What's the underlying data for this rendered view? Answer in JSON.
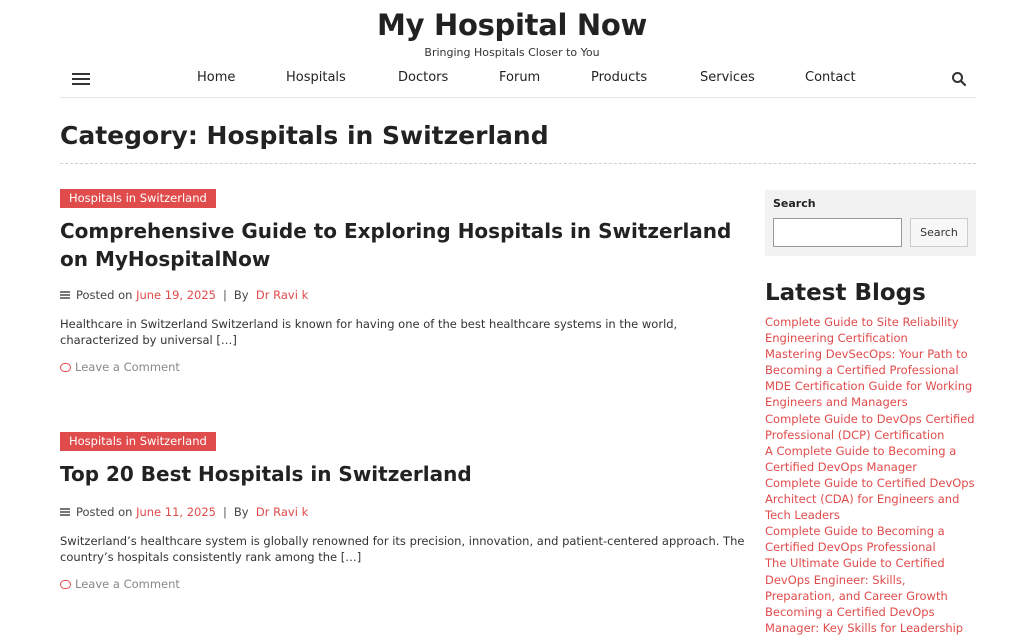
{
  "site": {
    "title": "My Hospital Now",
    "tagline": "Bringing Hospitals Closer to You"
  },
  "nav": {
    "menu_icon": "hamburger-menu-icon",
    "items": [
      "Home",
      "Hospitals",
      "Doctors",
      "Forum",
      "Products",
      "Services",
      "Contact"
    ],
    "search_icon": "search-icon"
  },
  "page": {
    "title": "Category: Hospitals in Switzerland"
  },
  "posts": [
    {
      "category": "Hospitals in Switzerland",
      "title": "Comprehensive Guide to Exploring Hospitals in Switzerland on MyHospitalNow",
      "posted_on_label": "Posted on",
      "date": "June 19, 2025",
      "separator": "|",
      "by_label": "By",
      "author": "Dr Ravi k",
      "excerpt": "Healthcare in Switzerland Switzerland is known for having one of the best healthcare systems in the world, characterized by universal […]",
      "comment_link": "Leave a Comment"
    },
    {
      "category": "Hospitals in Switzerland",
      "title": "Top 20 Best Hospitals in Switzerland",
      "posted_on_label": "Posted on",
      "date": "June 11, 2025",
      "separator": "|",
      "by_label": "By",
      "author": "Dr Ravi k",
      "excerpt": "Switzerland’s healthcare system is globally renowned for its precision, innovation, and patient-centered approach. The country’s hospitals consistently rank among the […]",
      "comment_link": "Leave a Comment"
    }
  ],
  "sidebar": {
    "search": {
      "label": "Search",
      "input_value": "",
      "button_label": "Search"
    },
    "latest_blogs": {
      "heading": "Latest Blogs",
      "items": [
        "Complete Guide to Site Reliability Engineering Certification",
        "Mastering DevSecOps: Your Path to Becoming a Certified Professional",
        "MDE Certification Guide for Working Engineers and Managers",
        "Complete Guide to DevOps Certified Professional (DCP) Certification",
        "A Complete Guide to Becoming a Certified DevOps Manager",
        "Complete Guide to Certified DevOps Architect (CDA) for Engineers and Tech Leaders",
        "Complete Guide to Becoming a Certified DevOps Professional",
        "The Ultimate Guide to Certified DevOps Engineer: Skills, Preparation, and Career Growth",
        "Becoming a Certified DevOps Manager: Key Skills for Leadership"
      ]
    }
  },
  "colors": {
    "accent": "#e04b4b",
    "text": "#222222",
    "muted": "#888888",
    "widget_bg": "#f2f2f2"
  }
}
